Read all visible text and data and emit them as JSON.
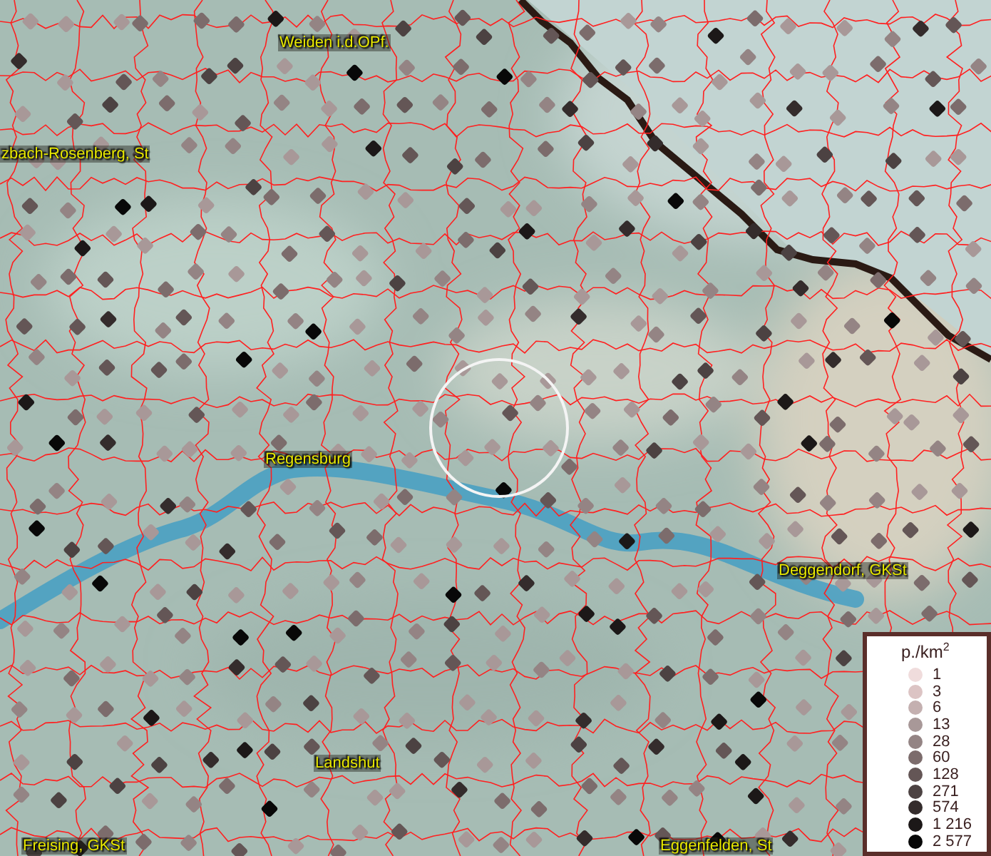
{
  "map": {
    "places": [
      {
        "label": "Weiden i.d.OPf."
      },
      {
        "label": "zbach-Rosenberg, St"
      },
      {
        "label": "Regensburg"
      },
      {
        "label": "Deggendorf, GKSt"
      },
      {
        "label": "Landshut"
      },
      {
        "label": "Freising, GKSt"
      },
      {
        "label": "Eggenfelden, St"
      }
    ]
  },
  "legend": {
    "title": "p./km$^{2}$",
    "items": [
      {
        "label": "1",
        "color": "#f0dcdc"
      },
      {
        "label": "3",
        "color": "#dcc4c4"
      },
      {
        "label": "6",
        "color": "#c4b0b0"
      },
      {
        "label": "13",
        "color": "#a89898"
      },
      {
        "label": "28",
        "color": "#948484"
      },
      {
        "label": "60",
        "color": "#7c6c6c"
      },
      {
        "label": "128",
        "color": "#645656"
      },
      {
        "label": "271",
        "color": "#4c4242"
      },
      {
        "label": "574",
        "color": "#342c2c"
      },
      {
        "label": "1 216",
        "color": "#1c1818"
      },
      {
        "label": "2 577",
        "color": "#080808"
      }
    ]
  }
}
